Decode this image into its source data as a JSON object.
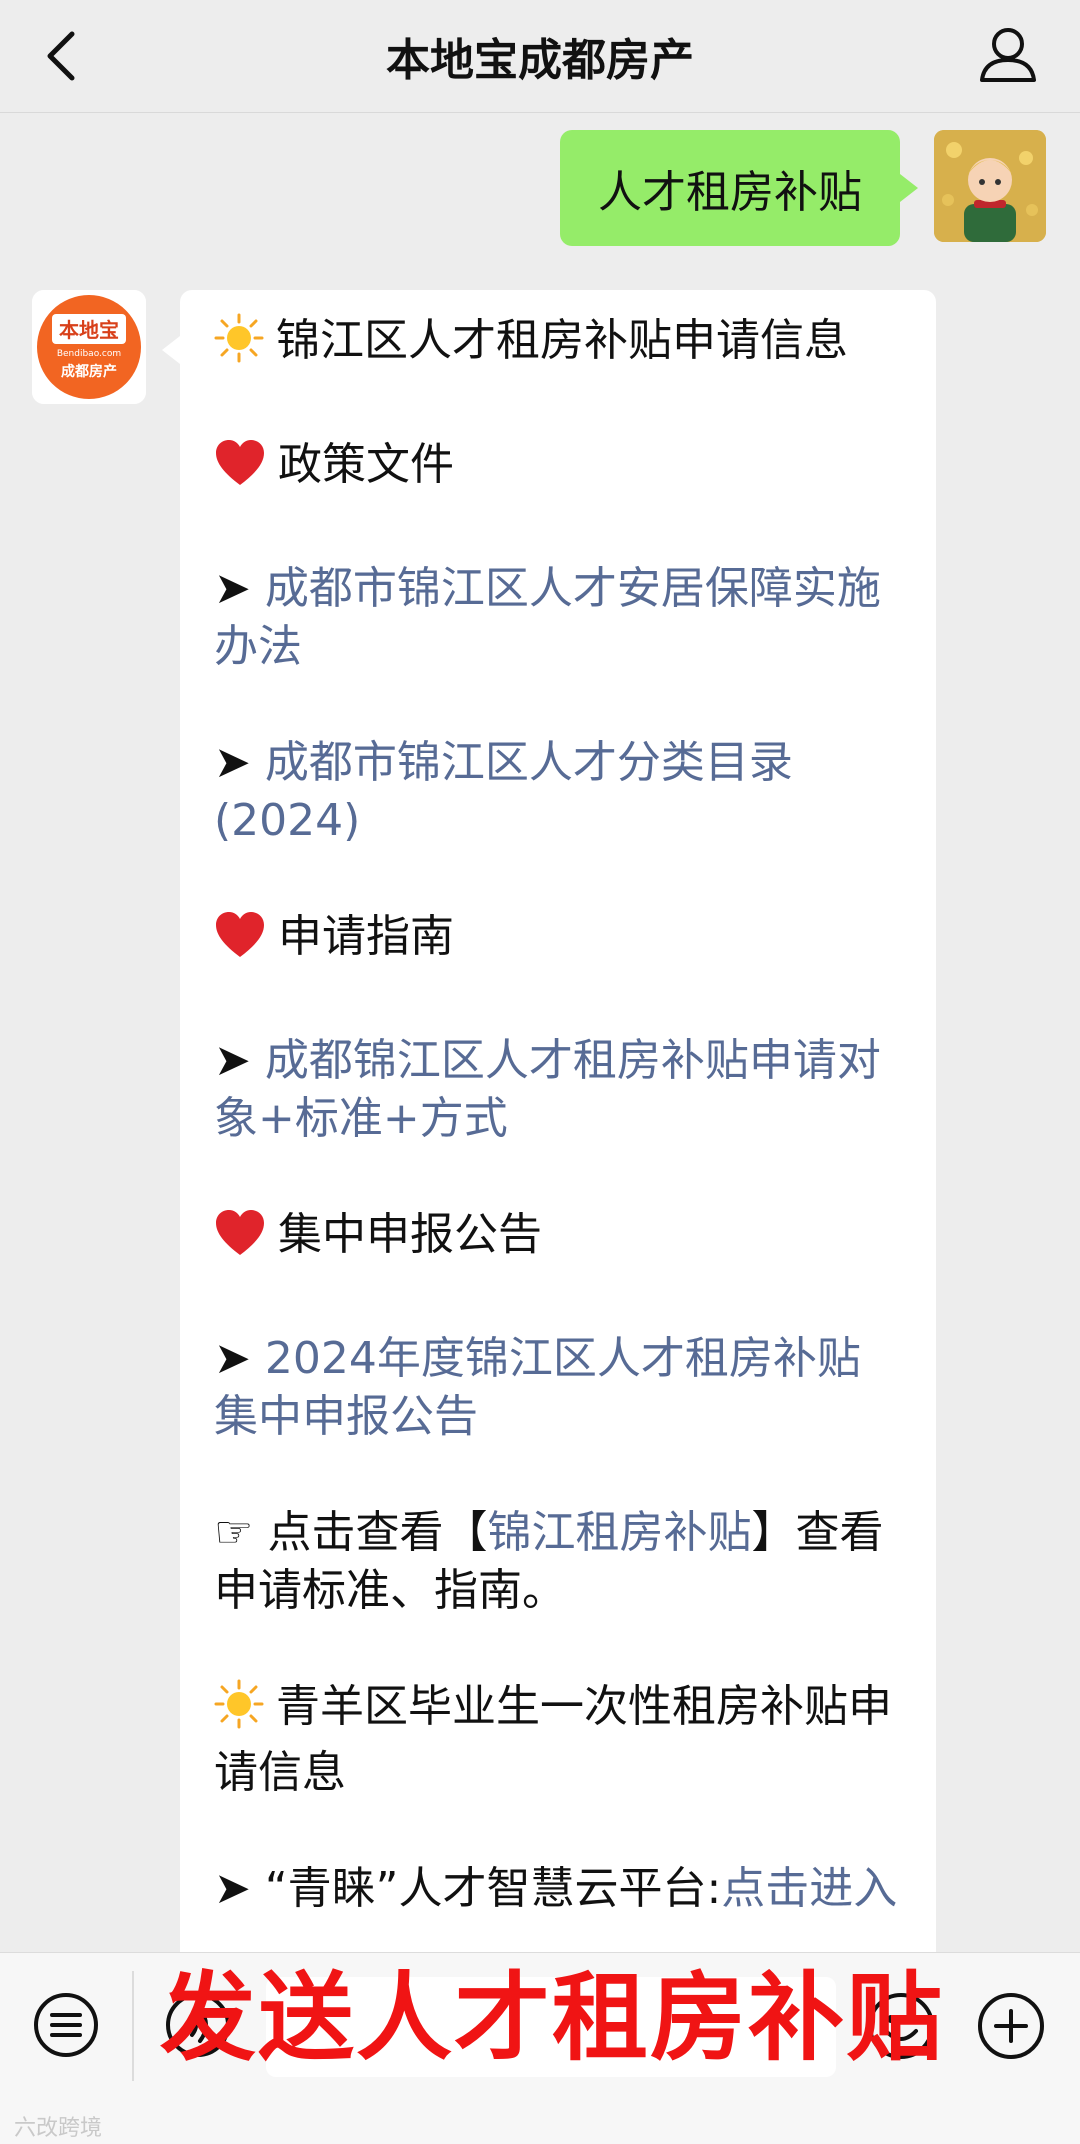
{
  "header": {
    "title": "本地宝成都房产"
  },
  "chat": {
    "sent_message": "人才租房补贴",
    "bot_avatar": {
      "brand": "本地宝",
      "domain": "Bendibao.com",
      "subtitle": "成都房产"
    },
    "reply": {
      "section1_title": "锦江区人才租房补贴申请信息",
      "heading_policy": "政策文件",
      "link_policy_1": "成都市锦江区人才安居保障实施办法",
      "link_policy_2": "成都市锦江区人才分类目录(2024)",
      "heading_guide": "申请指南",
      "link_guide": "成都锦江区人才租房补贴申请对象+标准+方式",
      "heading_notice": "集中申报公告",
      "link_notice": "2024年度锦江区人才租房补贴集中申报公告",
      "click_prefix": "点击查看【",
      "click_link": "锦江租房补贴",
      "click_suffix": "】查看申请标准、指南。",
      "section2_title": "青羊区毕业生一次性租房补贴申请信息",
      "platform_prefix": "“青睐”人才智慧云平台:",
      "platform_link": "点击进入"
    }
  },
  "overlay": {
    "caption": "发送人才租房补贴"
  },
  "watermark": "六改跨境",
  "colors": {
    "sent_bubble": "#95ec69",
    "link": "#576b95",
    "caption": "#f01414",
    "background": "#ededed"
  },
  "icons": [
    "back-icon",
    "profile-icon",
    "sun-icon",
    "heart-icon",
    "arrow-icon",
    "pointing-hand-icon",
    "menu-icon",
    "voice-icon",
    "emoji-icon",
    "plus-icon"
  ]
}
